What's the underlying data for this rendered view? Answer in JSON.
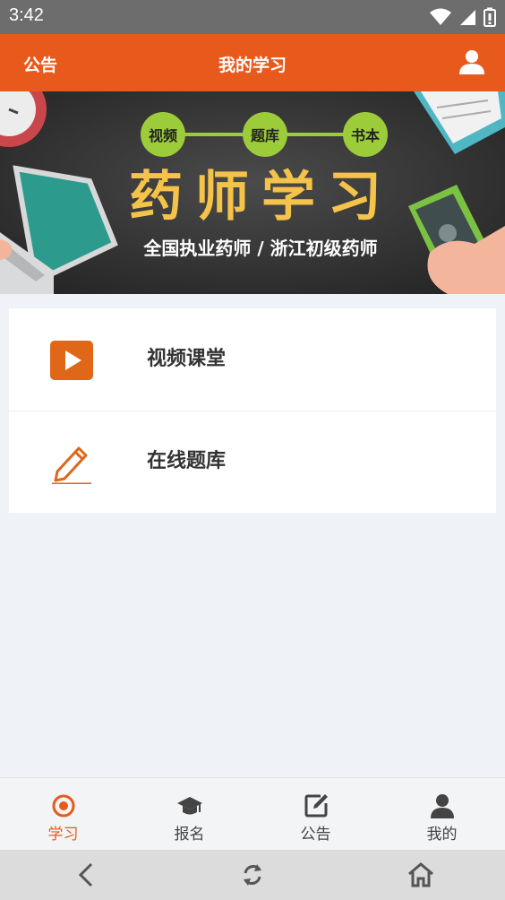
{
  "status": {
    "time": "3:42"
  },
  "header": {
    "left_label": "公告",
    "title": "我的学习"
  },
  "banner": {
    "chips": [
      "视频",
      "题库",
      "书本"
    ],
    "title": "药师学习",
    "subtitle": "全国执业药师 / 浙江初级药师"
  },
  "menu": [
    {
      "label": "视频课堂",
      "icon": "play-icon"
    },
    {
      "label": "在线题库",
      "icon": "pencil-icon"
    }
  ],
  "tabs": [
    {
      "label": "学习",
      "icon": "target-icon",
      "active": true
    },
    {
      "label": "报名",
      "icon": "graduation-cap-icon",
      "active": false
    },
    {
      "label": "公告",
      "icon": "edit-icon",
      "active": false
    },
    {
      "label": "我的",
      "icon": "user-icon",
      "active": false
    }
  ],
  "colors": {
    "accent": "#e85a1b",
    "chip": "#9ccc3a",
    "banner_title": "#f5c34a"
  }
}
